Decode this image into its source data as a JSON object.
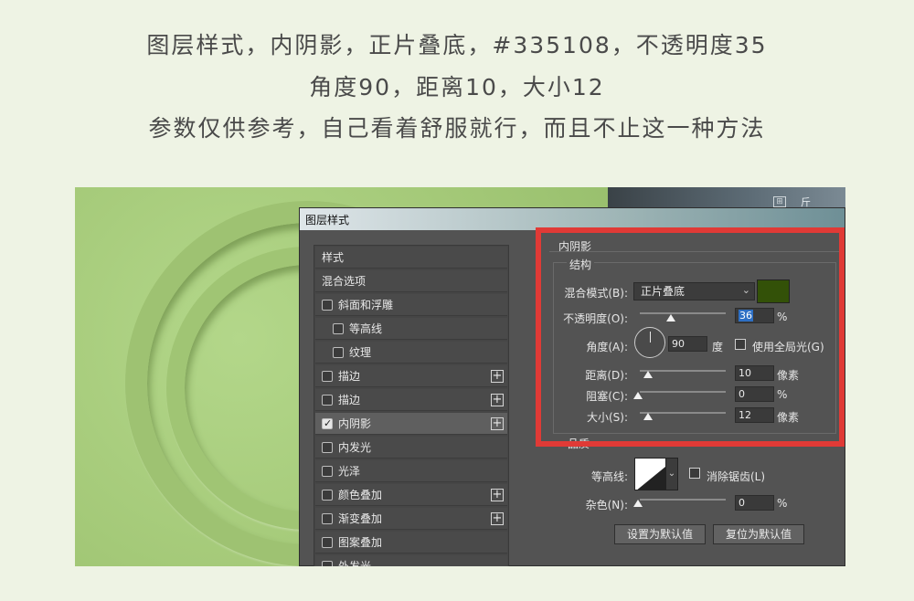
{
  "captions": {
    "line1": "图层样式，内阴影，正片叠底，#335108，不透明度35",
    "line2": "角度90，距离10，大小12",
    "line3": "参数仅供参考，自己看着舒服就行，而且不止这一种方法"
  },
  "dialog": {
    "title": "图层样式",
    "left_items": [
      {
        "label": "样式",
        "checkbox": false,
        "checked": false,
        "plus": false,
        "indent": 0
      },
      {
        "label": "混合选项",
        "checkbox": false,
        "checked": false,
        "plus": false,
        "indent": 0
      },
      {
        "label": "斜面和浮雕",
        "checkbox": true,
        "checked": false,
        "plus": false,
        "indent": 0
      },
      {
        "label": "等高线",
        "checkbox": true,
        "checked": false,
        "plus": false,
        "indent": 1
      },
      {
        "label": "纹理",
        "checkbox": true,
        "checked": false,
        "plus": false,
        "indent": 1
      },
      {
        "label": "描边",
        "checkbox": true,
        "checked": false,
        "plus": true,
        "indent": 0
      },
      {
        "label": "描边",
        "checkbox": true,
        "checked": false,
        "plus": true,
        "indent": 0
      },
      {
        "label": "内阴影",
        "checkbox": true,
        "checked": true,
        "plus": true,
        "indent": 0
      },
      {
        "label": "内发光",
        "checkbox": true,
        "checked": false,
        "plus": false,
        "indent": 0
      },
      {
        "label": "光泽",
        "checkbox": true,
        "checked": false,
        "plus": false,
        "indent": 0
      },
      {
        "label": "颜色叠加",
        "checkbox": true,
        "checked": false,
        "plus": true,
        "indent": 0
      },
      {
        "label": "渐变叠加",
        "checkbox": true,
        "checked": false,
        "plus": true,
        "indent": 0
      },
      {
        "label": "图案叠加",
        "checkbox": true,
        "checked": false,
        "plus": false,
        "indent": 0
      },
      {
        "label": "外发光",
        "checkbox": true,
        "checked": false,
        "plus": false,
        "indent": 0
      }
    ],
    "selected_index": 7,
    "section_title": "内阴影",
    "structure_title": "结构",
    "blend_mode_label": "混合模式(B):",
    "blend_mode_value": "正片叠底",
    "shadow_color": "#335108",
    "opacity_label": "不透明度(O):",
    "opacity_value": "36",
    "opacity_fraction": 0.36,
    "percent": "%",
    "angle_label": "角度(A):",
    "angle_value": "90",
    "degree_unit": "度",
    "global_light_label": "使用全局光(G)",
    "distance_label": "距离(D):",
    "distance_value": "10",
    "choke_label": "阻塞(C):",
    "choke_value": "0",
    "size_label": "大小(S):",
    "size_value": "12",
    "pixel_unit": "像素",
    "quality_title": "品质",
    "contour_label": "等高线:",
    "anti_alias_label": "消除锯齿(L)",
    "noise_label": "杂色(N):",
    "noise_value": "0",
    "make_default_button": "设置为默认值",
    "reset_default_button": "复位为默认值",
    "corner_icon": "⊞",
    "corner_text": "斤"
  },
  "colors": {
    "highlight_box": "#e03a36",
    "caption_text": "#4a4a4a",
    "page_bg": "#eef3e4"
  }
}
